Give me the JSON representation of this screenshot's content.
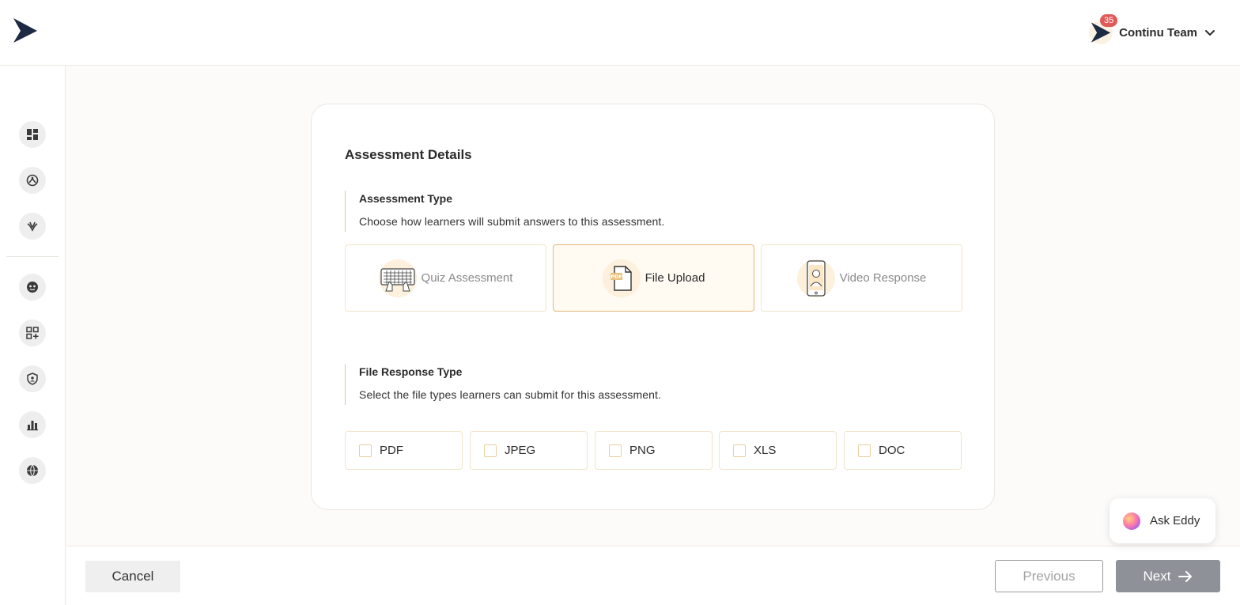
{
  "header": {
    "logo_icon": "continu-logo-icon",
    "notification_count": "35",
    "user_name": "Continu Team",
    "dropdown_icon": "chevron-down-icon"
  },
  "sidebar": {
    "items": [
      {
        "icon": "dashboard-icon",
        "label": ""
      },
      {
        "icon": "explore-icon",
        "label": ""
      },
      {
        "icon": "learning-icon",
        "label": ""
      },
      {
        "icon": "face-icon",
        "label": ""
      },
      {
        "icon": "add-widget-icon",
        "label": ""
      },
      {
        "icon": "admin-shield-icon",
        "label": ""
      },
      {
        "icon": "analytics-icon",
        "label": ""
      },
      {
        "icon": "globe-icon",
        "label": ""
      }
    ]
  },
  "card": {
    "title": "Assessment Details",
    "assessment_type": {
      "title": "Assessment Type",
      "description": "Choose how learners will submit answers to this assessment.",
      "options": [
        {
          "label": "Quiz Assessment",
          "icon": "keyboard-icon",
          "selected": false
        },
        {
          "label": "File Upload",
          "icon": "pdf-file-icon",
          "selected": true
        },
        {
          "label": "Video Response",
          "icon": "phone-video-icon",
          "selected": false
        }
      ]
    },
    "file_response_type": {
      "title": "File Response Type",
      "description": "Select the file types learners can submit for this assessment.",
      "options": [
        {
          "label": "PDF",
          "checked": false
        },
        {
          "label": "JPEG",
          "checked": false
        },
        {
          "label": "PNG",
          "checked": false
        },
        {
          "label": "XLS",
          "checked": false
        },
        {
          "label": "DOC",
          "checked": false
        }
      ]
    }
  },
  "ask_eddy": {
    "label": "Ask Eddy"
  },
  "footer": {
    "cancel_label": "Cancel",
    "previous_label": "Previous",
    "next_label": "Next"
  },
  "colors": {
    "accent": "#e2b97a",
    "accent_bg": "#fffaf2",
    "brand_dark": "#1d2a44",
    "badge": "#e05a5a",
    "next_button": "#8e9198"
  }
}
